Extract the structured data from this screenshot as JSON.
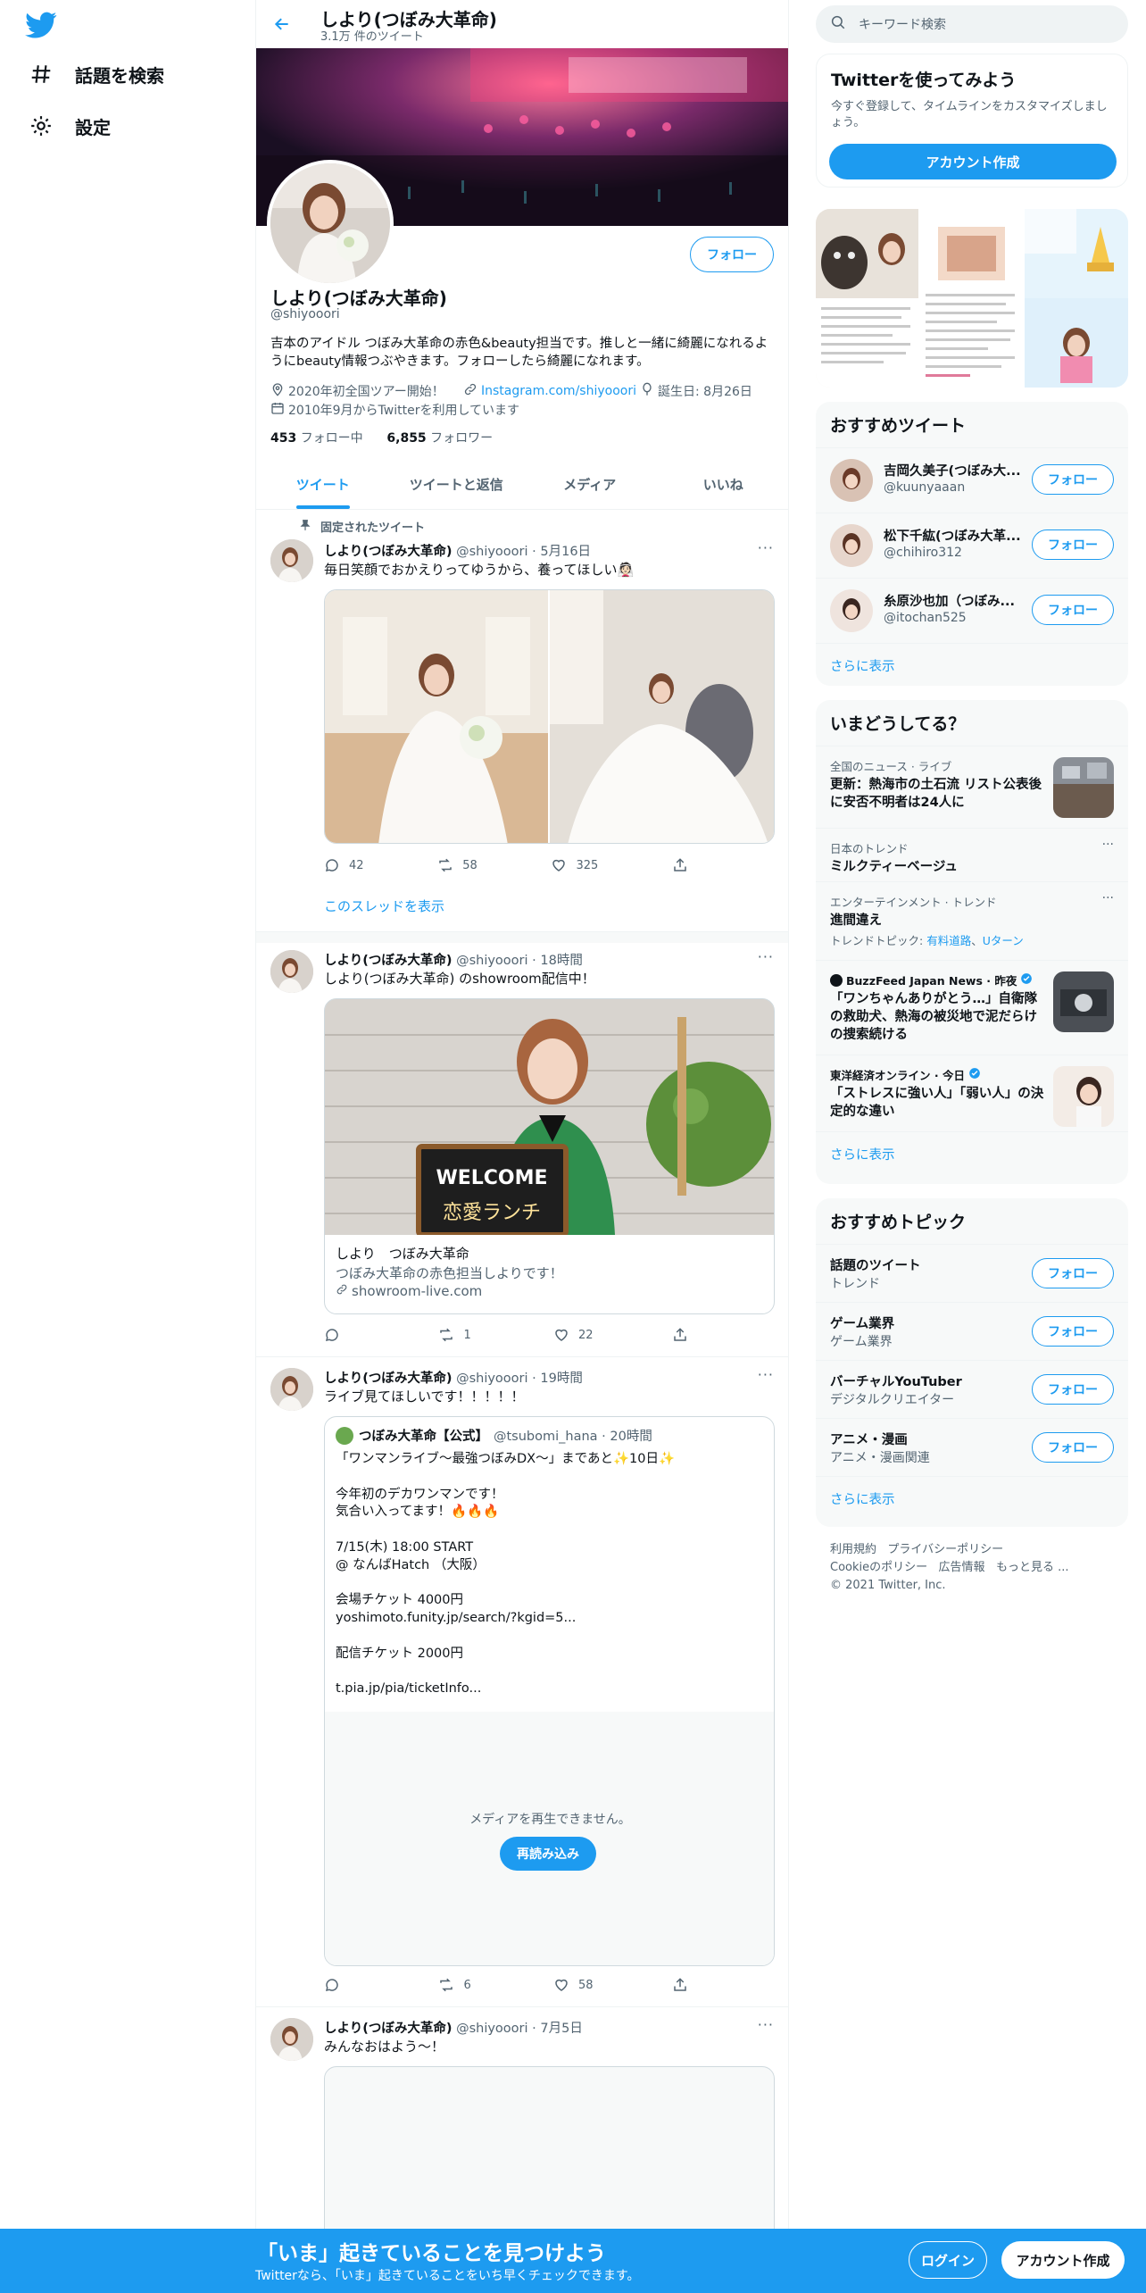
{
  "nav": {
    "explore_label": "話題を検索",
    "settings_label": "設定"
  },
  "header": {
    "name": "しより(つぼみ大革命)",
    "tweet_count": "3.1万 件のツイート"
  },
  "profile": {
    "follow_label": "フォロー",
    "name": "しより(つぼみ大革命)",
    "handle": "@shiyooori",
    "bio": "吉本のアイドル つぼみ大革命の赤色&beauty担当です。推しと一緒に綺麗になれるようにbeauty情報つぶやきます。フォローしたら綺麗になれます。",
    "location": "2020年初全国ツアー開始！",
    "link": "Instagram.com/shiyooori",
    "birthday": "誕生日: 8月26日",
    "joined": "2010年9月からTwitterを利用しています",
    "following_count": "453",
    "following_label": "フォロー中",
    "followers_count": "6,855",
    "followers_label": "フォロワー"
  },
  "tabs": [
    "ツイート",
    "ツイートと返信",
    "メディア",
    "いいね"
  ],
  "tweets": [
    {
      "pinned_label": "固定されたツイート",
      "name": "しより(つぼみ大革命)",
      "handle": "@shiyooori",
      "time": "· 5月16日",
      "text": "毎日笑顔でおかえりってゆうから、養ってほしい👰🏻",
      "replies": "42",
      "retweets": "58",
      "likes": "325",
      "thread_link": "このスレッドを表示"
    },
    {
      "name": "しより(つぼみ大革命)",
      "handle": "@shiyooori",
      "time": "· 18時間",
      "text": "しより(つぼみ大革命) のshowroom配信中！",
      "card_title": "しより　つぼみ大革命",
      "card_desc": "つぼみ大革命の赤色担当しよりです！",
      "card_link": "showroom-live.com",
      "card_sign_text": "WELCOME",
      "card_sign_sub": "恋愛ランチ",
      "replies": "",
      "retweets": "1",
      "likes": "22"
    },
    {
      "name": "しより(つぼみ大革命)",
      "handle": "@shiyooori",
      "time": "· 19時間",
      "text": "ライブ見てほしいです！！！！！",
      "quote": {
        "name": "つぼみ大革命【公式】",
        "handle": "@tsubomi_hana · 20時間",
        "lines": [
          "「ワンマンライブ〜最強つぼみDX〜」まであと✨10日✨",
          "",
          "今年初のデカワンマンです！",
          "気合い入ってます！🔥🔥🔥",
          "",
          "7/15(木) 18:00 START",
          "@ なんばHatch （大阪）",
          "",
          "会場チケット 4000円",
          "yoshimoto.funity.jp/search/?kgid=5...",
          "",
          "配信チケット 2000円",
          "",
          "t.pia.jp/pia/ticketInfo..."
        ],
        "media_error": "メディアを再生できません。",
        "reload_label": "再読み込み"
      },
      "replies": "",
      "retweets": "6",
      "likes": "58"
    },
    {
      "name": "しより(つぼみ大革命)",
      "handle": "@shiyooori",
      "time": "· 7月5日",
      "text": "みんなおはよう〜！"
    }
  ],
  "sidebar": {
    "search_placeholder": "キーワード検索",
    "signup": {
      "title": "Twitterを使ってみよう",
      "desc": "今すぐ登録して、タイムラインをカスタマイズしましょう。",
      "button": "アカウント作成"
    },
    "recommended_users": {
      "title": "おすすめツイート",
      "users": [
        {
          "name": "吉岡久美子(つぼみ大...",
          "handle": "@kuunyaaan"
        },
        {
          "name": "松下千紘(つぼみ大革...",
          "handle": "@chihiro312"
        },
        {
          "name": "糸原沙也加（つぼみ...",
          "handle": "@itochan525"
        }
      ],
      "follow_label": "フォロー",
      "more": "さらに表示"
    },
    "trends": {
      "title": "いまどうしてる？",
      "items": [
        {
          "context": "全国のニュース · ライブ",
          "title": "更新：熱海市の土石流 リスト公表後に安否不明者は24人に"
        },
        {
          "context": "日本のトレンド",
          "title": "ミルクティーベージュ"
        },
        {
          "context": "エンターテインメント · トレンド",
          "title": "進間違え",
          "related_prefix": "トレンドトピック: ",
          "related_1": "有料道路",
          "related_2": "Uターン"
        },
        {
          "context": "BuzzFeed Japan News · 昨夜",
          "title": "「ワンちゃんありがとう…」自衛隊の救助犬、熱海の被災地で泥だらけの捜索続ける"
        },
        {
          "context": "東洋経済オンライン · 今日",
          "title": "「ストレスに強い人」「弱い人」の決定的な違い"
        }
      ],
      "more": "さらに表示"
    },
    "topics": {
      "title": "おすすめトピック",
      "items": [
        {
          "name": "話題のツイート",
          "category": "トレンド"
        },
        {
          "name": "ゲーム業界",
          "category": "ゲーム業界"
        },
        {
          "name": "バーチャルYouTuber",
          "category": "デジタルクリエイター"
        },
        {
          "name": "アニメ・漫画",
          "category": "アニメ・漫画関連"
        }
      ],
      "follow_label": "フォロー",
      "more": "さらに表示"
    },
    "footer": {
      "links": [
        "利用規約",
        "プライバシーポリシー",
        "Cookieのポリシー",
        "広告情報",
        "もっと見る ..."
      ],
      "copyright": "© 2021 Twitter, Inc."
    }
  },
  "bottom_bar": {
    "title": "「いま」起きていることを見つけよう",
    "subtitle": "Twitterなら、「いま」起きていることをいち早くチェックできます。",
    "login": "ログイン",
    "signup": "アカウント作成"
  },
  "colors": {
    "accent": "#1d9bf0",
    "text": "#0f1419",
    "secondary": "#536471"
  }
}
